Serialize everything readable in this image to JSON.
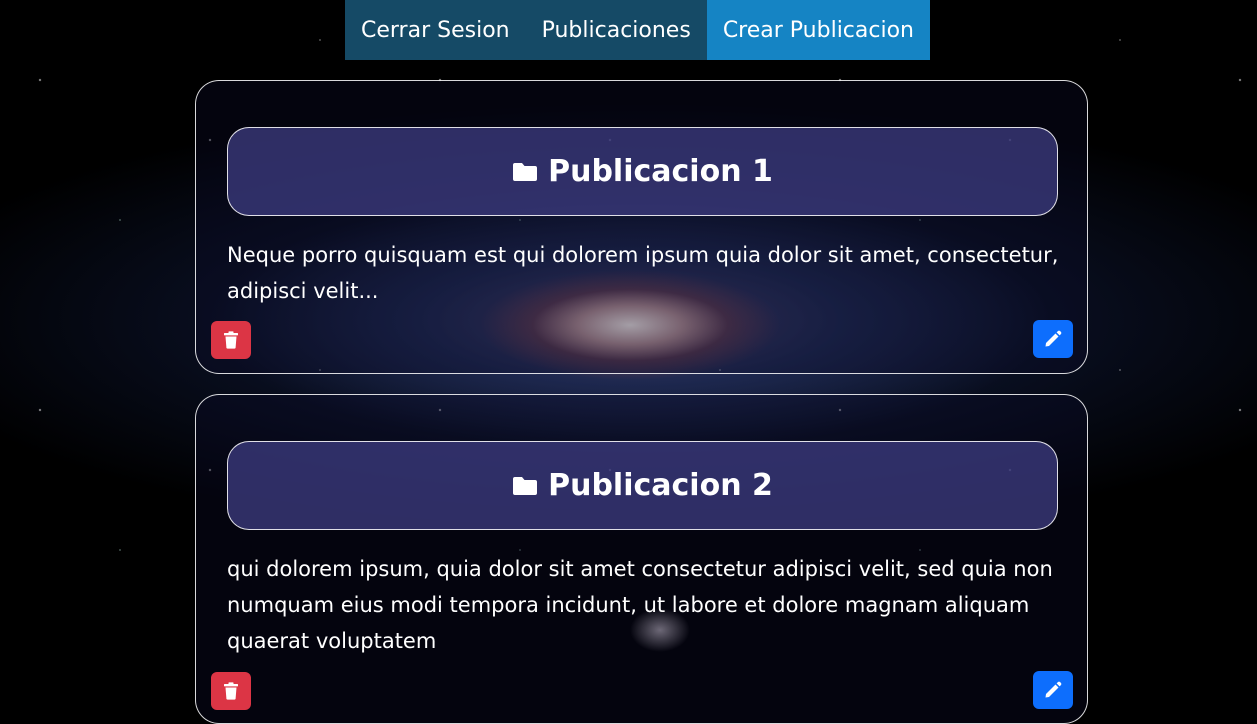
{
  "nav": {
    "items": [
      {
        "label": "Cerrar Sesion",
        "active": false
      },
      {
        "label": "Publicaciones",
        "active": false
      },
      {
        "label": "Crear Publicacion",
        "active": true
      }
    ]
  },
  "posts": [
    {
      "icon": "folder-icon",
      "title": "Publicacion 1",
      "body": "Neque porro quisquam est qui dolorem ipsum quia dolor sit amet, consectetur, adipisci velit...",
      "delete_icon": "trash-icon",
      "edit_icon": "pencil-icon"
    },
    {
      "icon": "folder-icon",
      "title": "Publicacion 2",
      "body": "qui dolorem ipsum, quia dolor sit amet consectetur adipisci velit, sed quia non numquam eius modi tempora incidunt, ut labore et dolore magnam aliquam quaerat voluptatem",
      "delete_icon": "trash-icon",
      "edit_icon": "pencil-icon"
    }
  ],
  "colors": {
    "nav_bg": "#154a66",
    "nav_active": "#1584c4",
    "danger": "#dc3545",
    "primary": "#0d6efd"
  }
}
